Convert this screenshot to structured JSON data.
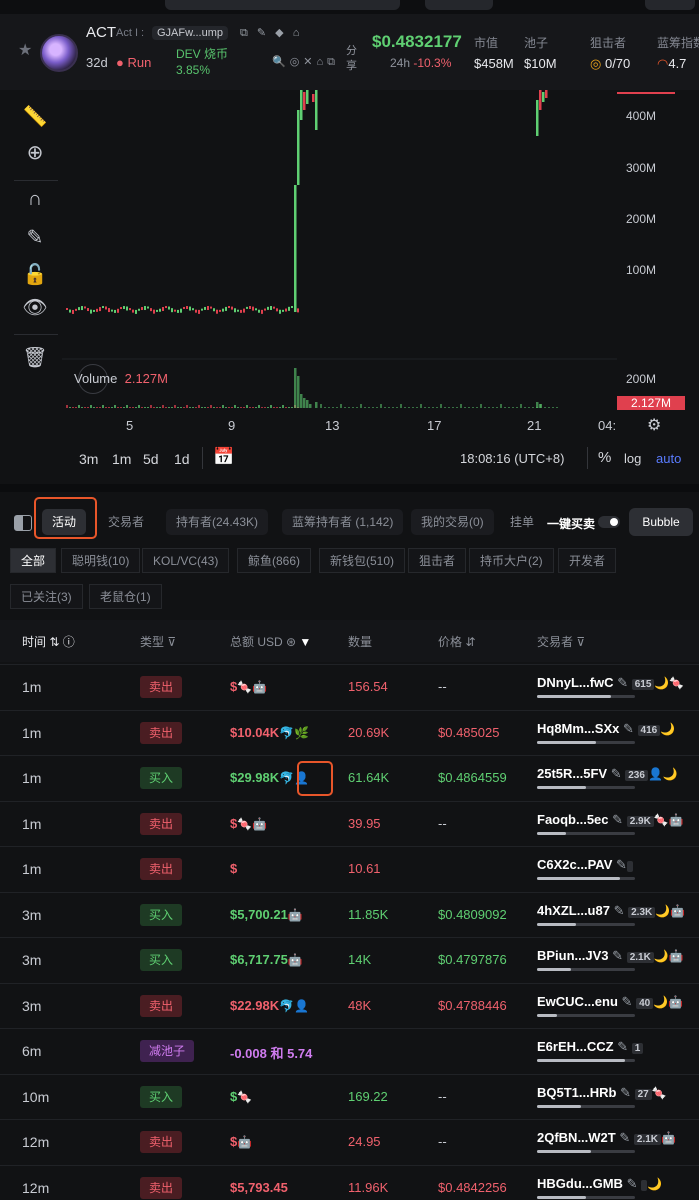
{
  "header": {
    "symbol": "ACT",
    "full_name": "Act I :",
    "address": "GJAFw...ump",
    "age": "32d",
    "run_label": "Run",
    "dev_label": "DEV 烧币",
    "dev_pct": "3.85%",
    "share": "分享",
    "price": "$0.4832177",
    "change_label": "24h",
    "change_value": "-10.3%",
    "stats": [
      {
        "label": "市值",
        "value": "$458M"
      },
      {
        "label": "池子",
        "value": "$10M"
      },
      {
        "label": "狙击者",
        "value": "0/70"
      },
      {
        "label": "蓝筹指数",
        "value": "4.7"
      }
    ]
  },
  "toolbar": [
    "ruler-icon",
    "zoom-in-icon",
    "magnet-icon",
    "pencil-lock-icon",
    "unlock-icon",
    "eye-icon",
    "trash-icon"
  ],
  "chart": {
    "y_labels": [
      "400M",
      "300M",
      "200M",
      "100M"
    ],
    "vol_labels": [
      "200M"
    ],
    "volume_label": "Volume",
    "volume_value": "2.127M",
    "volume_tag": "2.127M",
    "x_labels": [
      "5",
      "9",
      "13",
      "17",
      "21",
      "04:"
    ],
    "timeframes": [
      "3m",
      "1m",
      "5d",
      "1d"
    ],
    "time": "18:08:16 (UTC+8)",
    "percent": "%",
    "log": "log",
    "auto": "auto"
  },
  "chart_data": {
    "type": "line",
    "title": "",
    "x": [
      "5",
      "9",
      "13",
      "17",
      "21"
    ],
    "series": [
      {
        "values": [
          0.02,
          0.02,
          0.45,
          0.45,
          0.48
        ]
      }
    ],
    "ylim": [
      0,
      450
    ],
    "xlabel": "",
    "ylabel": ""
  },
  "tabs": {
    "items": [
      "活动",
      "交易者",
      "持有者(24.43K)",
      "蓝筹持有者 (1,142)",
      "我的交易(0)",
      "挂单"
    ],
    "one_click": "一键买卖",
    "bubble": "Bubble"
  },
  "filters": {
    "row1": [
      "全部",
      "聪明钱(10)",
      "KOL/VC(43)",
      "鲸鱼(866)",
      "新钱包(510)",
      "狙击者",
      "持币大户(2)",
      "开发者"
    ],
    "row2": [
      "已关注(3)",
      "老鼠仓(1)"
    ]
  },
  "table": {
    "headers": [
      "时间",
      "类型",
      "总额 USD",
      "数量",
      "价格",
      "交易者"
    ],
    "rows": [
      {
        "time": "1m",
        "type": "卖出",
        "kind": "sell",
        "amount": "$",
        "amount_icons": "🍬🤖",
        "qty": "156.54",
        "price": "--",
        "trader": "DNnyL...fwC",
        "count": "615",
        "tags": "🌙🍬",
        "bar": 0.75
      },
      {
        "time": "1m",
        "type": "卖出",
        "kind": "sell",
        "amount": "$10.04K",
        "amount_icons": "🐬🌿",
        "qty": "20.69K",
        "price": "$0.485025",
        "trader": "Hq8Mm...SXx",
        "count": "416",
        "tags": "🌙",
        "bar": 0.6
      },
      {
        "time": "1m",
        "type": "买入",
        "kind": "buy",
        "amount": "$29.98K",
        "amount_icons": "🐬👤",
        "qty": "61.64K",
        "price": "$0.4864559",
        "trader": "25t5R...5FV",
        "count": "236",
        "tags": "👤🌙",
        "bar": 0.5
      },
      {
        "time": "1m",
        "type": "卖出",
        "kind": "sell",
        "amount": "$",
        "amount_icons": "🍬🤖",
        "qty": "39.95",
        "price": "--",
        "trader": "Faoqb...5ec",
        "count": "2.9K",
        "tags": "🍬🤖",
        "bar": 0.3
      },
      {
        "time": "1m",
        "type": "卖出",
        "kind": "sell",
        "amount": "$",
        "amount_icons": "",
        "qty": "10.61",
        "price": "",
        "trader": "C6X2c...PAV",
        "count": "",
        "tags": "",
        "bar": 0.85
      },
      {
        "time": "3m",
        "type": "买入",
        "kind": "buy",
        "amount": "$5,700.21",
        "amount_icons": "🤖",
        "qty": "11.85K",
        "price": "$0.4809092",
        "trader": "4hXZL...u87",
        "count": "2.3K",
        "tags": "🌙🤖",
        "bar": 0.4
      },
      {
        "time": "3m",
        "type": "买入",
        "kind": "buy",
        "amount": "$6,717.75",
        "amount_icons": "🤖",
        "qty": "14K",
        "price": "$0.4797876",
        "trader": "BPiun...JV3",
        "count": "2.1K",
        "tags": "🌙🤖",
        "bar": 0.35
      },
      {
        "time": "3m",
        "type": "卖出",
        "kind": "sell",
        "amount": "$22.98K",
        "amount_icons": "🐬👤",
        "qty": "48K",
        "price": "$0.4788446",
        "trader": "EwCUC...enu",
        "count": "40",
        "tags": "🌙🤖",
        "bar": 0.2
      },
      {
        "time": "6m",
        "type": "减池子",
        "kind": "pool",
        "amount": "-0.008  和 5.74",
        "amount_icons": "",
        "qty": "",
        "price": "",
        "trader": "E6rEH...CCZ",
        "count": "1",
        "tags": "",
        "bar": 0.9
      },
      {
        "time": "10m",
        "type": "买入",
        "kind": "buy",
        "amount": "$",
        "amount_icons": "🍬",
        "qty": "169.22",
        "price": "--",
        "trader": "BQ5T1...HRb",
        "count": "27",
        "tags": "🍬",
        "bar": 0.45
      },
      {
        "time": "12m",
        "type": "卖出",
        "kind": "sell",
        "amount": "$",
        "amount_icons": "🤖",
        "qty": "24.95",
        "price": "--",
        "trader": "2QfBN...W2T",
        "count": "2.1K",
        "tags": "🤖",
        "bar": 0.55
      },
      {
        "time": "12m",
        "type": "卖出",
        "kind": "sell",
        "amount": "$5,793.45",
        "amount_icons": "",
        "qty": "11.96K",
        "price": "$0.4842256",
        "trader": "HBGdu...GMB",
        "count": "",
        "tags": "🌙",
        "bar": 0.5
      }
    ]
  }
}
